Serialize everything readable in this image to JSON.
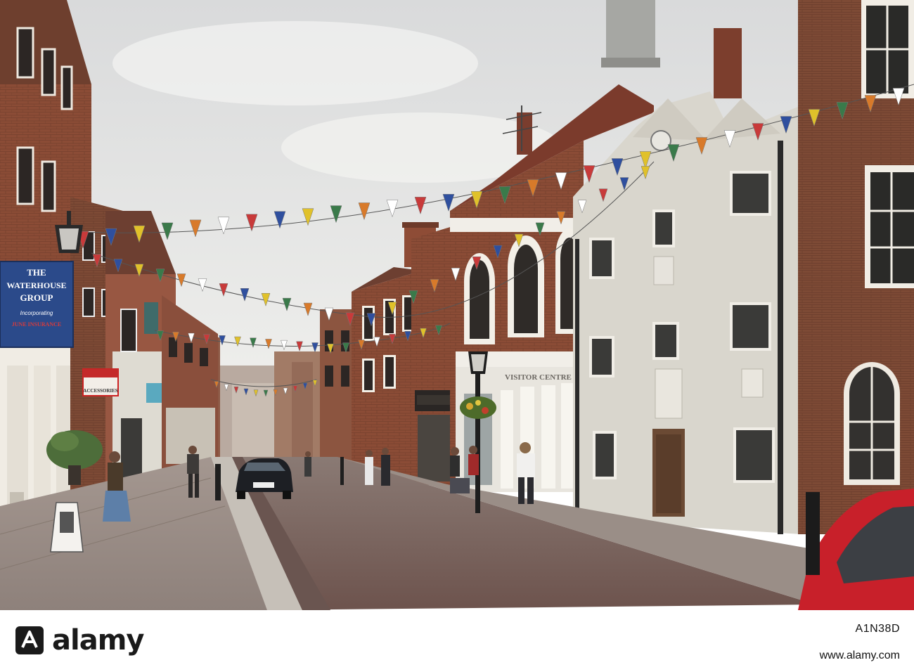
{
  "scene": {
    "signs": {
      "waterhouse_line1": "THE",
      "waterhouse_line2": "WATERHOUSE",
      "waterhouse_line3": "GROUP",
      "waterhouse_line4": "Incorporating",
      "waterhouse_line5": "JUNE INSURANCE",
      "small_sign_bottom": "ACCESSORIES",
      "visitor_centre": "VISITOR CENTRE"
    },
    "colors": {
      "sky": "#e6e6e3",
      "brick": "#8a4a34",
      "stone": "#d8d6ce",
      "pavement": "#9e8f86",
      "road": "#7a5f58",
      "sign_blue": "#2b4a8a",
      "red_car": "#c8202a"
    },
    "bunting_colors": [
      "#c83a3a",
      "#2f4f9e",
      "#e0c12a",
      "#3a7a4a",
      "#d87a2a",
      "#ffffff"
    ]
  },
  "footer": {
    "brand": "alamy",
    "image_id": "A1N38D",
    "site": "www.alamy.com"
  }
}
